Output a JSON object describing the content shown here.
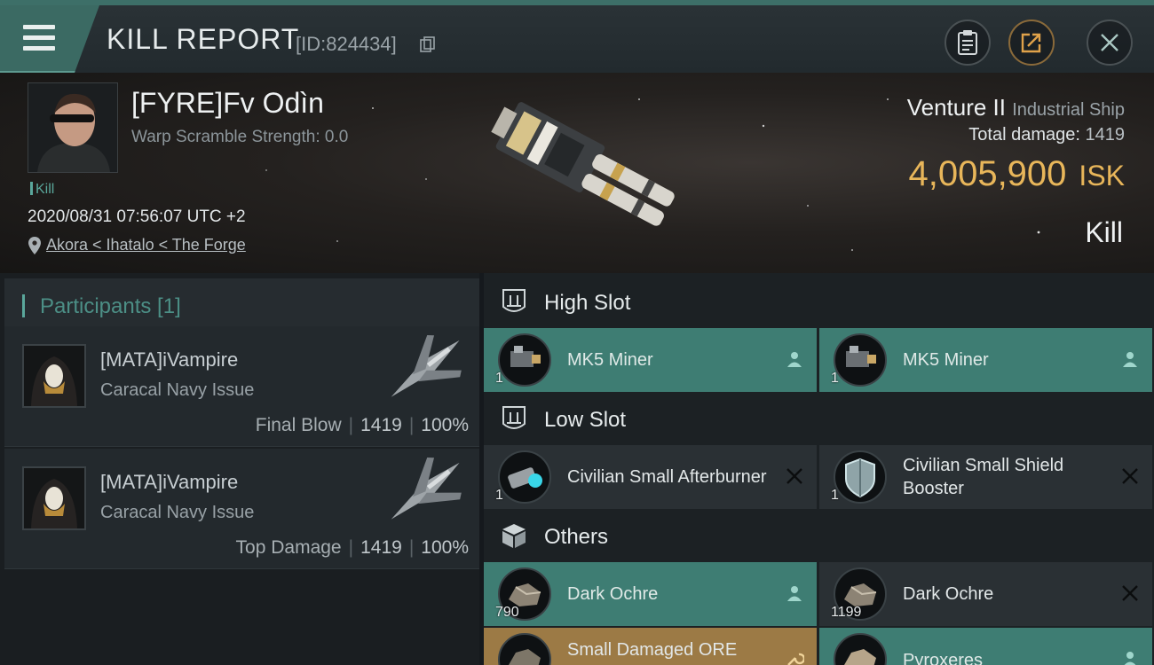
{
  "header": {
    "title": "KILL REPORT",
    "report_id": "[ID:824434]"
  },
  "victim": {
    "pilot_name": "[FYRE]Fv Odìn",
    "warp_scramble": "Warp Scramble Strength: 0.0",
    "kill_tag": "Kill",
    "datetime": "2020/08/31 07:56:07 UTC +2",
    "location": "Akora < Ihatalo < The Forge",
    "ship_name": "Venture II",
    "ship_class": "Industrial Ship",
    "total_damage_label": "Total damage:",
    "total_damage": "1419",
    "isk_value": "4,005,900",
    "isk_unit": "ISK",
    "result": "Kill"
  },
  "participants": {
    "label": "Participants [1]",
    "rows": [
      {
        "name": "[MATA]iVampire",
        "ship": "Caracal Navy Issue",
        "tag": "Final Blow",
        "damage": "1419",
        "percent": "100%"
      },
      {
        "name": "[MATA]iVampire",
        "ship": "Caracal Navy Issue",
        "tag": "Top Damage",
        "damage": "1419",
        "percent": "100%"
      }
    ]
  },
  "fitting": {
    "sections": [
      {
        "label": "High Slot",
        "icon": "high-slot-icon"
      },
      {
        "label": "Low Slot",
        "icon": "low-slot-icon"
      },
      {
        "label": "Others",
        "icon": "cargo-box-icon"
      }
    ],
    "high": [
      {
        "name": "MK5 Miner",
        "qty": "1",
        "status": "dropped-person-icon"
      },
      {
        "name": "MK5 Miner",
        "qty": "1",
        "status": "dropped-person-icon"
      }
    ],
    "low": [
      {
        "name": "Civilian Small Afterburner",
        "qty": "1",
        "status": "destroyed-x-icon"
      },
      {
        "name": "Civilian Small Shield Booster",
        "qty": "1",
        "status": "destroyed-x-icon"
      }
    ],
    "others": [
      {
        "name": "Dark Ochre",
        "qty": "790",
        "status": "dropped-person-icon"
      },
      {
        "name": "Dark Ochre",
        "qty": "1199",
        "status": "destroyed-x-icon"
      },
      {
        "name": "Small Damaged ORE",
        "qty": "",
        "status": "wrench-icon"
      },
      {
        "name": "Pyroxeres",
        "qty": "",
        "status": "dropped-person-icon"
      }
    ]
  },
  "colors": {
    "accent_teal": "#3e7d73",
    "isk_gold": "#e8b65a",
    "ore_tan": "#9c7a45"
  }
}
